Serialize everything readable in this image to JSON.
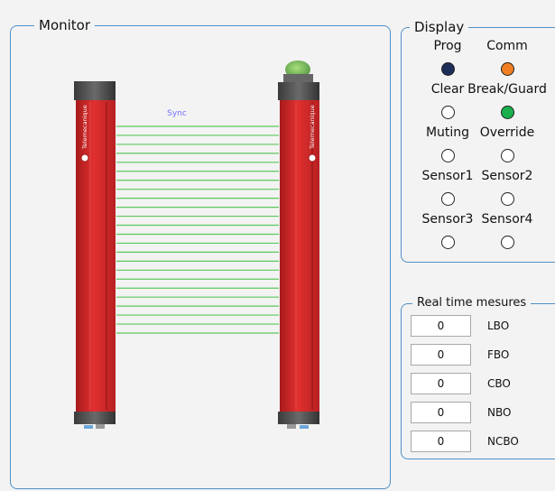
{
  "monitor": {
    "legend": "Monitor",
    "sync_label": "Sync",
    "brand": "Telemecanique",
    "beam_count": 24,
    "beam_color": "#5cc85c",
    "column_color": "#d72a2c",
    "sync_color": "#7070ff"
  },
  "display": {
    "legend": "Display",
    "indicators": [
      {
        "label": "Prog",
        "color": "#1c2e57"
      },
      {
        "label": "Comm",
        "color": "#f07f23"
      },
      {
        "label": "Clear",
        "color": "#ffffff"
      },
      {
        "label": "Break/Guard",
        "color": "#19b04d"
      },
      {
        "label": "Muting",
        "color": "#ffffff"
      },
      {
        "label": "Override",
        "color": "#ffffff"
      },
      {
        "label": "Sensor1",
        "color": "#ffffff"
      },
      {
        "label": "Sensor2",
        "color": "#ffffff"
      },
      {
        "label": "Sensor3",
        "color": "#ffffff"
      },
      {
        "label": "Sensor4",
        "color": "#ffffff"
      }
    ]
  },
  "realtime": {
    "legend": "Real time mesures",
    "rows": [
      {
        "value": "0",
        "label": "LBO"
      },
      {
        "value": "0",
        "label": "FBO"
      },
      {
        "value": "0",
        "label": "CBO"
      },
      {
        "value": "0",
        "label": "NBO"
      },
      {
        "value": "0",
        "label": "NCBO"
      }
    ]
  }
}
